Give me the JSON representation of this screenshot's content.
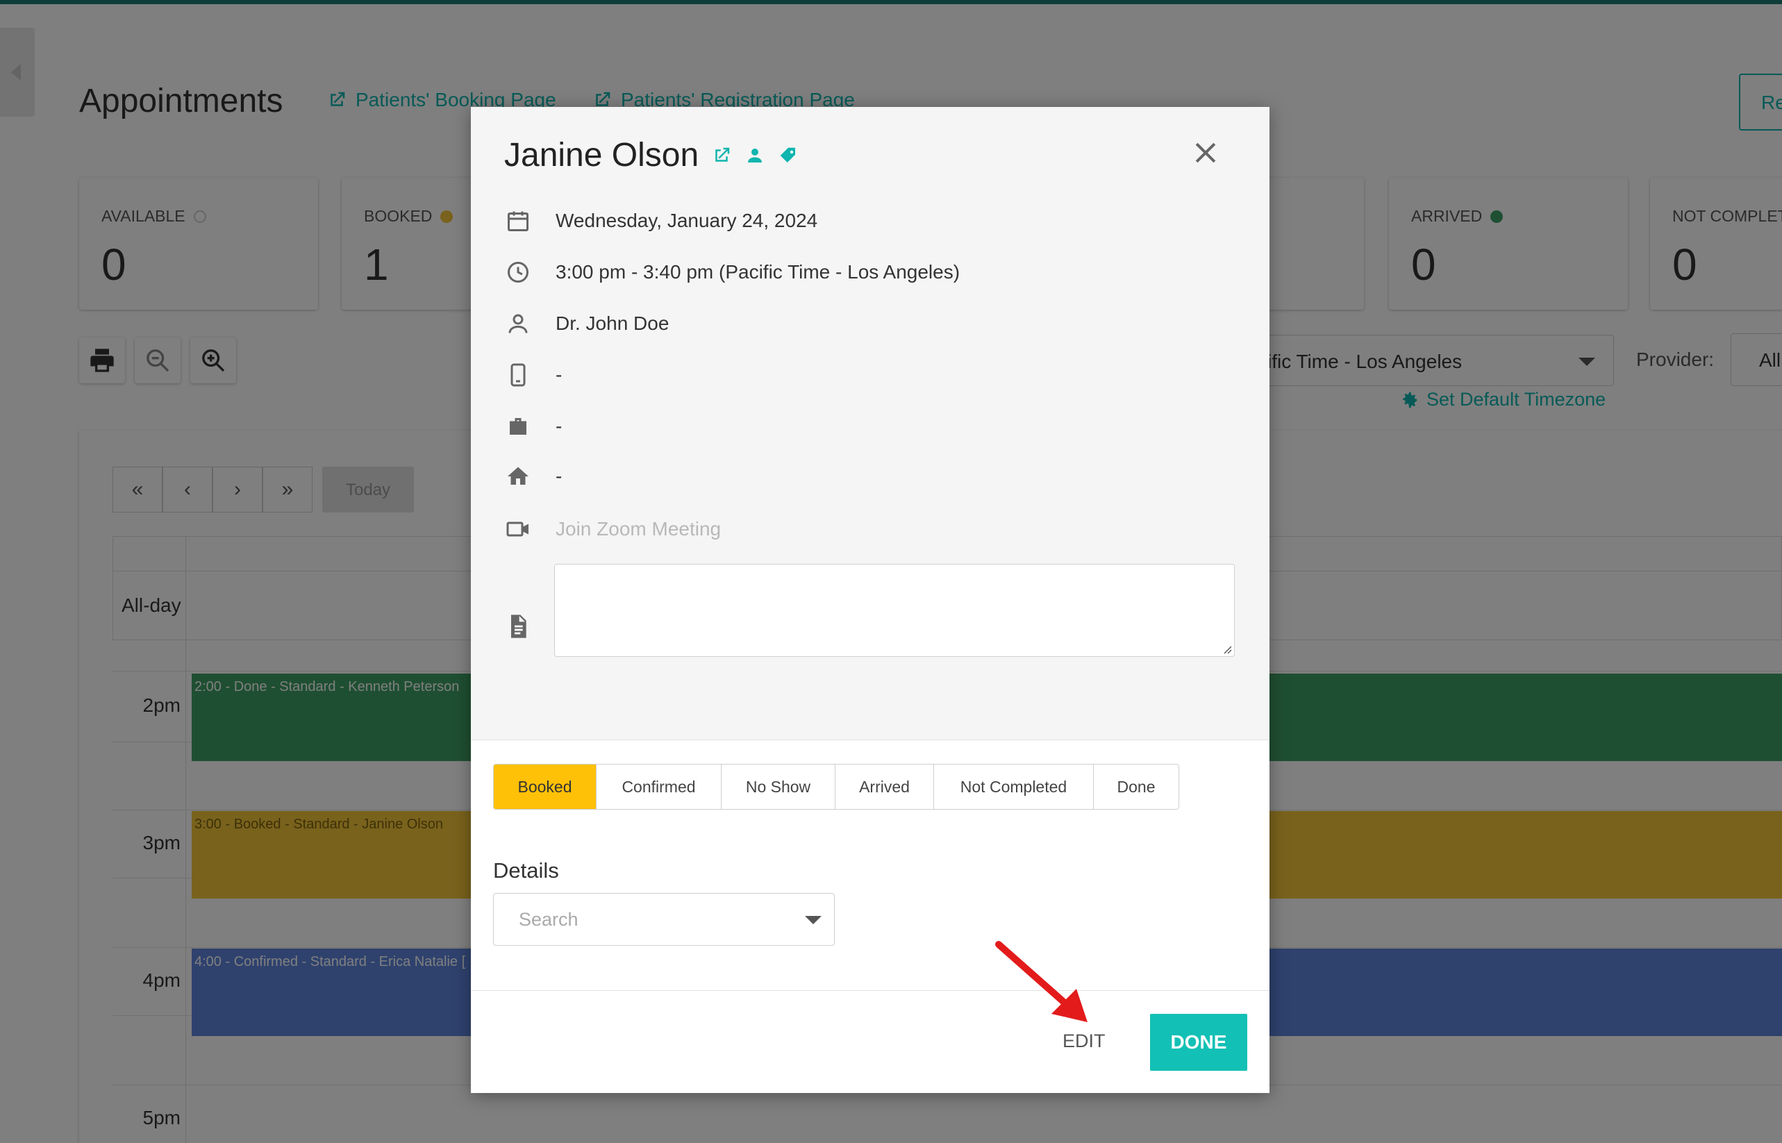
{
  "header": {
    "title": "Appointments",
    "booking_link": "Patients' Booking Page",
    "registration_link": "Patients' Registration Page",
    "right_button": "Re"
  },
  "stats": [
    {
      "label": "AVAILABLE",
      "value": "0",
      "color": "#cfcfcf"
    },
    {
      "label": "BOOKED",
      "value": "1",
      "color": "#f2c438"
    },
    {
      "label": "ARRIVED",
      "value": "0",
      "color": "#3f9e64"
    },
    {
      "label": "NOT COMPLET",
      "value": "0",
      "color": ""
    }
  ],
  "toolbar": {
    "timezone_value": "cific Time - Los Angeles",
    "provider_label": "Provider:",
    "provider_value": "All",
    "set_default_tz": "Set Default Timezone"
  },
  "calendar": {
    "nav": [
      "«",
      "‹",
      "›",
      "»"
    ],
    "today_label": "Today",
    "allday_label": "All-day",
    "times": [
      "2pm",
      "3pm",
      "4pm",
      "5pm"
    ],
    "events": [
      {
        "label": "2:00 - Done - Standard - Kenneth Peterson"
      },
      {
        "label": "3:00 - Booked - Standard - Janine Olson"
      },
      {
        "label": "4:00 - Confirmed - Standard - Erica Natalie ["
      }
    ]
  },
  "modal": {
    "patient_name": "Janine Olson",
    "date": "Wednesday, January 24, 2024",
    "time": "3:00 pm - 3:40 pm (Pacific Time - Los Angeles)",
    "provider": "Dr. John Doe",
    "mobile": "-",
    "work": "-",
    "home": "-",
    "zoom_link": "Join Zoom Meeting",
    "notes_value": "",
    "statuses": [
      "Booked",
      "Confirmed",
      "No Show",
      "Arrived",
      "Not Completed",
      "Done"
    ],
    "active_status": "Booked",
    "details_label": "Details",
    "details_placeholder": "Search",
    "edit_label": "EDIT",
    "done_label": "DONE"
  },
  "colors": {
    "accent": "#0fb5ae",
    "booked": "#ffc107",
    "done_button": "#13c0b5",
    "annotation_arrow": "#e31b1b"
  }
}
